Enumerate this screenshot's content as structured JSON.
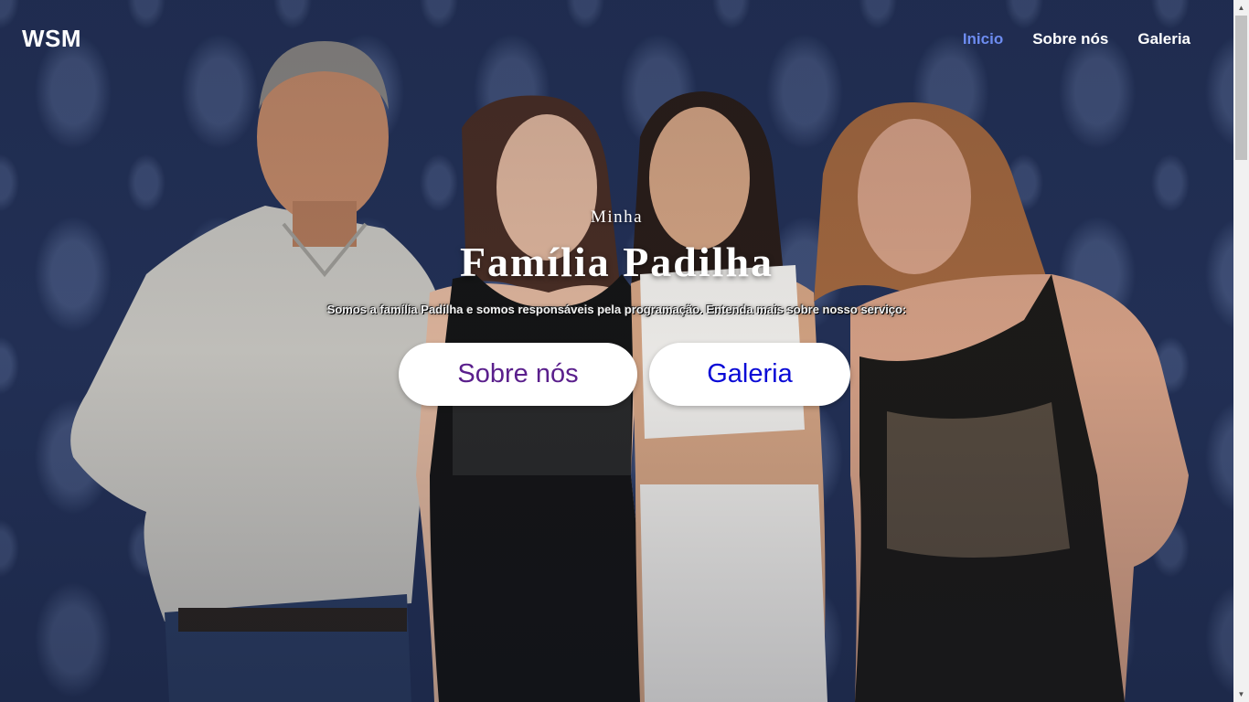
{
  "navbar": {
    "brand": "WSM",
    "links": [
      {
        "label": "Inicio",
        "active": true
      },
      {
        "label": "Sobre nós",
        "active": false
      },
      {
        "label": "Galeria",
        "active": false
      }
    ],
    "active_color": "#6d8cf0"
  },
  "hero": {
    "kicker": "Minha",
    "title": "Família Padilha",
    "subtitle": "Somos a família Padilha e somos responsáveis pela programação. Entenda mais sobre nosso serviço:",
    "buttons": [
      {
        "label": "Sobre nós",
        "color": "#5a1f8c"
      },
      {
        "label": "Galeria",
        "color": "#0a0ad6"
      }
    ],
    "background": {
      "description_icon": "family-photo-icon",
      "wallpaper_color": "#233157"
    }
  },
  "scrollbar": {
    "up_icon": "arrow-up-icon",
    "down_icon": "arrow-down-icon"
  }
}
